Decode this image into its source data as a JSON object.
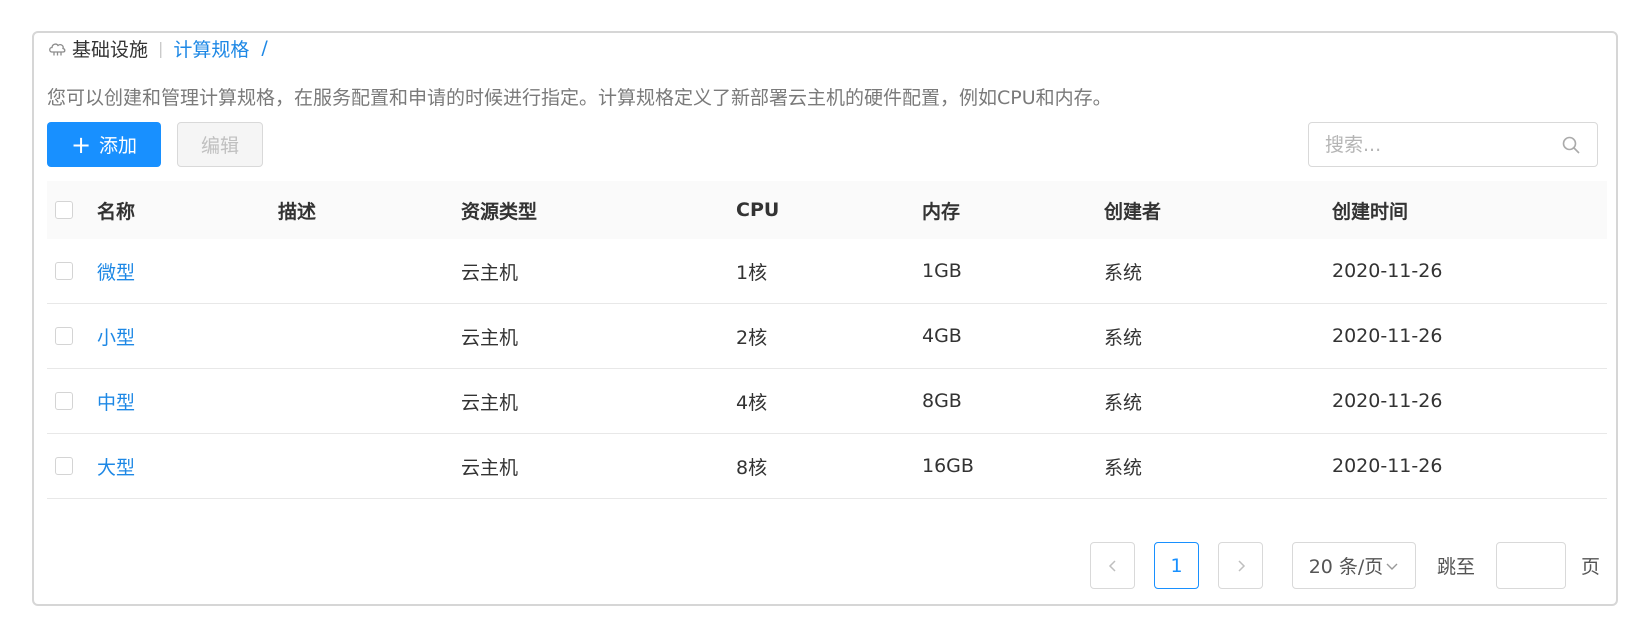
{
  "breadcrumb": {
    "icon": "cloud-icon",
    "root": "基础设施",
    "separator": "|",
    "current": "计算规格",
    "trail": "/"
  },
  "description": "您可以创建和管理计算规格，在服务配置和申请的时候进行指定。计算规格定义了新部署云主机的硬件配置，例如CPU和内存。",
  "toolbar": {
    "add_icon": "plus-icon",
    "add_label": "添加",
    "edit_label": "编辑"
  },
  "search": {
    "placeholder": "搜索...",
    "value": ""
  },
  "table": {
    "columns": [
      "名称",
      "描述",
      "资源类型",
      "CPU",
      "内存",
      "创建者",
      "创建时间"
    ],
    "rows": [
      {
        "name": "微型",
        "desc": "",
        "type": "云主机",
        "cpu": "1核",
        "mem": "1GB",
        "creator": "系统",
        "time": "2020-11-26"
      },
      {
        "name": "小型",
        "desc": "",
        "type": "云主机",
        "cpu": "2核",
        "mem": "4GB",
        "creator": "系统",
        "time": "2020-11-26"
      },
      {
        "name": "中型",
        "desc": "",
        "type": "云主机",
        "cpu": "4核",
        "mem": "8GB",
        "creator": "系统",
        "time": "2020-11-26"
      },
      {
        "name": "大型",
        "desc": "",
        "type": "云主机",
        "cpu": "8核",
        "mem": "16GB",
        "creator": "系统",
        "time": "2020-11-26"
      }
    ]
  },
  "pagination": {
    "current_page": "1",
    "page_size": "20 条/页",
    "jump_label": "跳至",
    "page_suffix": "页"
  },
  "colors": {
    "primary": "#1890ff",
    "link": "#1e88e5"
  }
}
